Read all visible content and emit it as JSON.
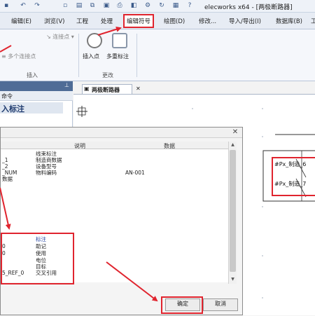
{
  "app": {
    "title": "elecworks x64 - [两极断路器]"
  },
  "menu": {
    "edit": "编辑(E)",
    "view": "浏览(V)",
    "project": "工程",
    "process": "处理",
    "edit_markup": "编辑符号",
    "drawing": "绘图(D)",
    "modify": "修改...",
    "import_export": "导入/导出(I)",
    "database": "数据库(B)",
    "tools": "工"
  },
  "ribbon": {
    "connect_point": "连接点",
    "multi_connect_point": "多个连接点",
    "insert_group": "插入",
    "insert_point": "插入点",
    "multi_remark": "多重标注",
    "change_group": "更改"
  },
  "left_panel": {
    "tab_label": "命令",
    "heading": "入标注"
  },
  "drawing": {
    "tab_label": "两极断路器",
    "tag_top": "#Px_制造_6",
    "tag_bottom": "#Px_制造_7"
  },
  "dialog": {
    "columns": {
      "desc": "说明",
      "data": "数据"
    },
    "top_rows": [
      {
        "name": "",
        "desc": "线束标注",
        "data": ""
      },
      {
        "name": "_1",
        "desc": "制造商数据",
        "data": ""
      },
      {
        "name": "_2",
        "desc": "设备型号",
        "data": ""
      },
      {
        "name": "_NUM",
        "desc": "物料编码",
        "data": "AN-001"
      },
      {
        "name": "数据",
        "desc": "",
        "data": ""
      }
    ],
    "bottom_rows": [
      {
        "name": "",
        "desc": "标注"
      },
      {
        "name": "0",
        "desc": "助记"
      },
      {
        "name": "0",
        "desc": "使用"
      },
      {
        "name": "",
        "desc": "电位"
      },
      {
        "name": "",
        "desc": "目标"
      },
      {
        "name": "5_REF_0",
        "desc": "交叉引用"
      }
    ],
    "ok": "确定",
    "cancel": "取消"
  },
  "colors": {
    "annotation": "#e0242e",
    "panel_header": "#4f6c96"
  }
}
